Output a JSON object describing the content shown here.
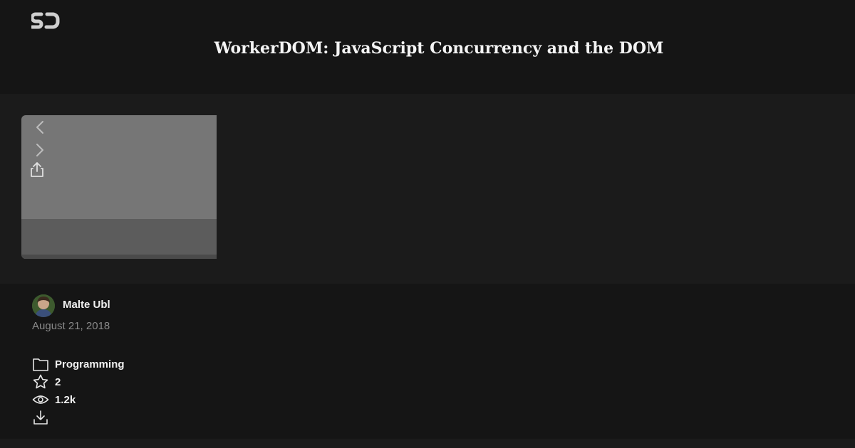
{
  "site": {
    "logo_icon": "speakerdeck-logo-icon"
  },
  "deck": {
    "title": "WorkerDOM: JavaScript Concurrency and the DOM"
  },
  "player": {
    "controls": [
      "chevron-left-icon",
      "chevron-right-icon",
      "share-icon"
    ]
  },
  "author": {
    "name": "Malte Ubl",
    "date": "August 21, 2018"
  },
  "stats": {
    "category": "Programming",
    "stars": "2",
    "views": "1.2k"
  },
  "colors": {
    "background": "#151515",
    "stage": "#1b1b1b",
    "slide": "#767676",
    "muted_text": "#8a8a8a"
  }
}
